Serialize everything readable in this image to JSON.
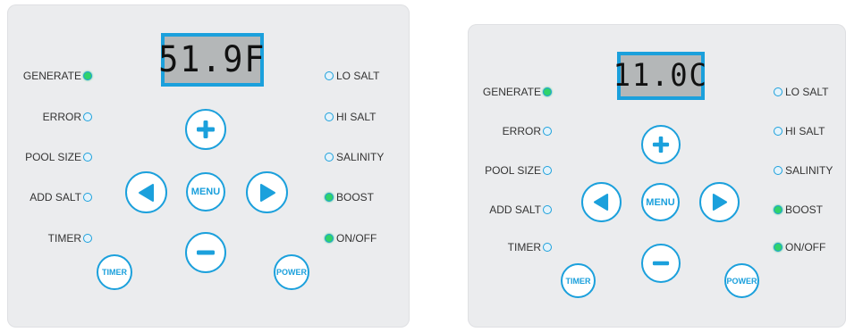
{
  "panels": [
    {
      "display": "51.9F",
      "left_indicators": [
        {
          "label": "GENERATE",
          "on": true
        },
        {
          "label": "ERROR",
          "on": false
        },
        {
          "label": "POOL SIZE",
          "on": false
        },
        {
          "label": "ADD SALT",
          "on": false
        },
        {
          "label": "TIMER",
          "on": false
        }
      ],
      "right_indicators": [
        {
          "label": "LO SALT",
          "on": false
        },
        {
          "label": "HI SALT",
          "on": false
        },
        {
          "label": "SALINITY",
          "on": false
        },
        {
          "label": "BOOST",
          "on": true
        },
        {
          "label": "ON/OFF",
          "on": true
        }
      ],
      "buttons": {
        "menu": "MENU",
        "timer": "TIMER",
        "power": "POWER"
      }
    },
    {
      "display": "11.0C",
      "left_indicators": [
        {
          "label": "GENERATE",
          "on": true
        },
        {
          "label": "ERROR",
          "on": false
        },
        {
          "label": "POOL SIZE",
          "on": false
        },
        {
          "label": "ADD SALT",
          "on": false
        },
        {
          "label": "TIMER",
          "on": false
        }
      ],
      "right_indicators": [
        {
          "label": "LO SALT",
          "on": false
        },
        {
          "label": "HI SALT",
          "on": false
        },
        {
          "label": "SALINITY",
          "on": false
        },
        {
          "label": "BOOST",
          "on": true
        },
        {
          "label": "ON/OFF",
          "on": true
        }
      ],
      "buttons": {
        "menu": "MENU",
        "timer": "TIMER",
        "power": "POWER"
      }
    }
  ],
  "colors": {
    "accent": "#1ba0dc",
    "led_on": "#2fd36a",
    "panel": "#ebecee",
    "lcd": "#b4b7b8"
  },
  "icons": {
    "up": "plus-icon",
    "down": "minus-icon",
    "left": "left-arrow-icon",
    "right": "right-arrow-icon"
  }
}
